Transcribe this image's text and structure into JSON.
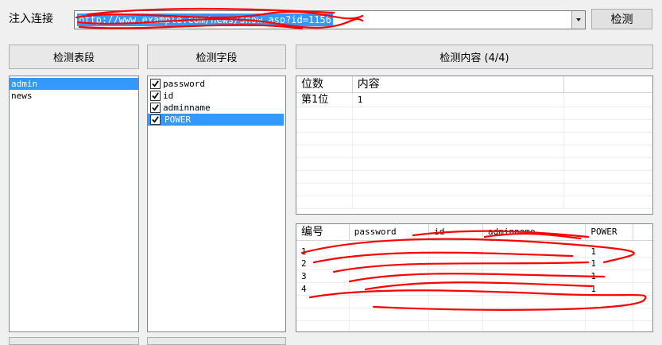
{
  "toolbar": {
    "url_label": "注入连接",
    "url_value": "http://www.example.com/news/show.asp?id=1156",
    "detect_button": "检测"
  },
  "tables_panel": {
    "header": "检测表段",
    "items": [
      {
        "label": "admin",
        "selected": true
      },
      {
        "label": "news",
        "selected": false
      }
    ]
  },
  "fields_panel": {
    "header": "检测字段",
    "items": [
      {
        "label": "password",
        "checked": true,
        "selected": false
      },
      {
        "label": "id",
        "checked": true,
        "selected": false
      },
      {
        "label": "adminname",
        "checked": true,
        "selected": false
      },
      {
        "label": "POWER",
        "checked": true,
        "selected": true
      }
    ]
  },
  "content_panel": {
    "header": "检测内容 (4/4)",
    "length_grid": {
      "columns": [
        "位数",
        "内容"
      ],
      "rows": [
        [
          "第1位",
          "1"
        ]
      ]
    },
    "result_grid": {
      "columns": [
        "编号",
        "password",
        "id",
        "adminname",
        "POWER"
      ],
      "rows": [
        [
          "1",
          "",
          "",
          "",
          "1"
        ],
        [
          "2",
          "",
          "",
          "",
          "1"
        ],
        [
          "3",
          "",
          "",
          "",
          "1"
        ],
        [
          "4",
          "",
          "",
          "",
          "1"
        ]
      ]
    }
  },
  "colors": {
    "selection": "#3399ff",
    "scribble": "#ff0000",
    "background": "#f0f0f0"
  }
}
